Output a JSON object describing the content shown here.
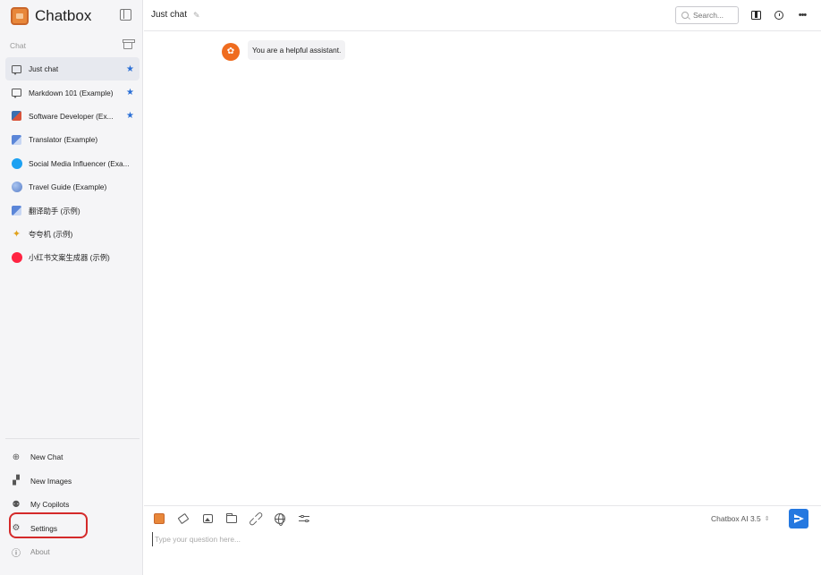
{
  "app": {
    "name": "Chatbox"
  },
  "sidebar": {
    "section_title": "Chat",
    "sessions": [
      {
        "label": "Just chat",
        "starred": true,
        "active": true,
        "icon": "chat-bubble-icon"
      },
      {
        "label": "Markdown 101 (Example)",
        "starred": true,
        "active": false,
        "icon": "chat-bubble-icon"
      },
      {
        "label": "Software Developer (Ex...",
        "starred": true,
        "active": false,
        "icon": "developer-avatar-icon"
      },
      {
        "label": "Translator (Example)",
        "starred": false,
        "active": false,
        "icon": "translator-avatar-icon"
      },
      {
        "label": "Social Media Influencer (Exa...",
        "starred": false,
        "active": false,
        "icon": "twitter-avatar-icon"
      },
      {
        "label": "Travel Guide (Example)",
        "starred": false,
        "active": false,
        "icon": "globe-avatar-icon"
      },
      {
        "label": "翻译助手 (示例)",
        "starred": false,
        "active": false,
        "icon": "translator-avatar-icon"
      },
      {
        "label": "夸夸机 (示例)",
        "starred": false,
        "active": false,
        "icon": "sparkle-avatar-icon"
      },
      {
        "label": "小红书文案生成器 (示例)",
        "starred": false,
        "active": false,
        "icon": "xiaohongshu-avatar-icon"
      }
    ],
    "bottom_menu": {
      "new_chat": "New Chat",
      "new_images": "New Images",
      "my_copilots": "My Copilots",
      "settings": "Settings",
      "about": "About"
    }
  },
  "header": {
    "chat_title": "Just chat",
    "search_placeholder": "Search..."
  },
  "messages": [
    {
      "role": "system",
      "text": "You are a helpful assistant."
    }
  ],
  "composer": {
    "placeholder": "Type your question here...",
    "model": "Chatbox AI 3.5"
  },
  "colors": {
    "accent": "#2478e0",
    "star": "#2a6fd6",
    "highlight": "#d42a2a",
    "system_avatar": "#ef6c1f"
  }
}
